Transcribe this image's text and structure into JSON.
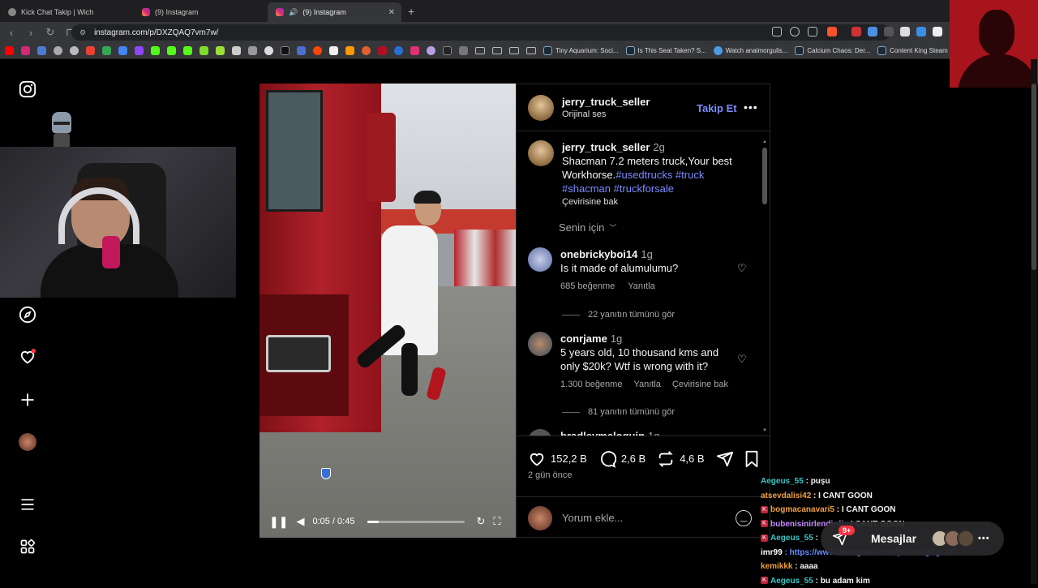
{
  "browser": {
    "tabs": [
      {
        "title": "Kick Chat Takip | Wich",
        "active": false
      },
      {
        "title": "(9) Instagram",
        "active": false
      },
      {
        "title": "(9) Instagram",
        "active": true
      }
    ],
    "url": "instagram.com/p/DXZQAQ7vm7w/",
    "bookmarks": [
      {
        "label": "Tiny Aquarium: Soci..."
      },
      {
        "label": "Is This Seat Taken? S..."
      },
      {
        "label": "Watch analmorgulis..."
      },
      {
        "label": "Calcium Chaos: Der..."
      },
      {
        "label": "Content King Steam"
      }
    ]
  },
  "video": {
    "time": "0:05 / 0:45",
    "progress": 0.11
  },
  "post": {
    "author": "jerry_truck_seller",
    "audio": "Orijinal ses",
    "follow_label": "Takip Et",
    "caption_author": "jerry_truck_seller",
    "caption_age": "2g",
    "caption_text": "Shacman 7.2 meters truck,Your best Workhorse.",
    "caption_tags1": "#usedtrucks #truck",
    "caption_tags2": "#shacman #truckforsale",
    "translate": "Çevirisine bak",
    "filter": "Senin için",
    "comments": [
      {
        "user": "onebrickyboi14",
        "age": "1g",
        "text": "Is it made of alumulumu?",
        "likes": "685 beğenme",
        "reply": "Yanıtla",
        "translate": "",
        "replies": "22 yanıtın tümünü gör"
      },
      {
        "user": "conrjame",
        "age": "1g",
        "text": "5 years old, 10 thousand kms and only $20k? Wtf is wrong with it?",
        "likes": "1.300 beğenme",
        "reply": "Yanıtla",
        "translate": "Çevirisine bak",
        "replies": "81 yanıtın tümünü gör"
      },
      {
        "user": "bradleymcloquin",
        "age": "1g"
      }
    ],
    "likes": "152,2 B",
    "comments_count": "2,6 B",
    "reposts": "4,6 B",
    "ago": "2 gün önce",
    "add_comment": "Yorum ekle..."
  },
  "chat": [
    {
      "user": "Aegeus_55",
      "msg": ": puşu",
      "color": "#3ac6c6",
      "badge": ""
    },
    {
      "user": "atsevdalisi42",
      "msg": ": I CANT GOON",
      "color": "#f0a040",
      "badge": ""
    },
    {
      "user": "bogmacanavari5",
      "msg": ": I CANT GOON",
      "color": "#f0a040",
      "badge": "K"
    },
    {
      "user": "bubenisinirlendirdi",
      "msg": ": I CANT GOON",
      "color": "#c88cff",
      "badge": "K"
    },
    {
      "user": "Aegeus_55",
      "msg": ":",
      "color": "#3ac6c6",
      "badge": "K"
    },
    {
      "user": "imr99",
      "msg": ": https://www.instagram.com/p/DVv0gIrgrJX/",
      "color": "#ffffff",
      "badge": ""
    },
    {
      "user": "kemikkk",
      "msg": ": aaaa",
      "color": "#f0a040",
      "badge": ""
    },
    {
      "user": "Aegeus_55",
      "msg": ": bu adam kim",
      "color": "#3ac6c6",
      "badge": "K"
    }
  ],
  "messages": {
    "label": "Mesajlar",
    "badge": "9+"
  }
}
